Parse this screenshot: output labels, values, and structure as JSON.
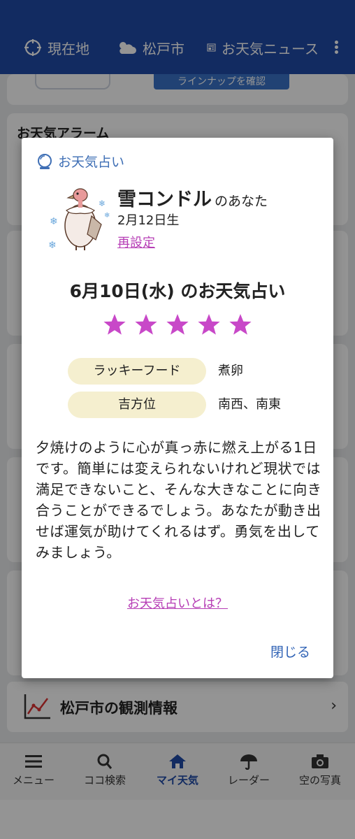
{
  "topbar": {
    "nav_current": "現在地",
    "nav_city": "松戸市",
    "nav_news": "お天気ニュース"
  },
  "background": {
    "lineup_button": "ラインナップを確認",
    "alarm_title": "お天気アラーム",
    "obs_label": "松戸市の観測情報"
  },
  "bottom_nav": {
    "items": [
      {
        "label": "メニュー",
        "icon": "menu-icon"
      },
      {
        "label": "ココ検索",
        "icon": "search-icon"
      },
      {
        "label": "マイ天気",
        "icon": "home-icon"
      },
      {
        "label": "レーダー",
        "icon": "umbrella-icon"
      },
      {
        "label": "空の写真",
        "icon": "camera-icon"
      }
    ],
    "active": "マイ天気"
  },
  "modal": {
    "header": "お天気占い",
    "name": "雪コンドル",
    "name_suffix": "のあなた",
    "birthday": "2月12日生",
    "reset": "再設定",
    "fortune_title": "6月10日(水) のお天気占い",
    "stars": 5,
    "star_color": "#c848c8",
    "lucky_food_label": "ラッキーフード",
    "lucky_food_value": "煮卵",
    "direction_label": "吉方位",
    "direction_value": "南西、南東",
    "description": "夕焼けのように心が真っ赤に燃え上がる1日です。簡単には変えられないけれど現状では満足できないこと、そんな大きなことに向き合うことができるでしょう。あなたが動き出せば運気が助けてくれるはず。勇気を出してみましょう。",
    "about_link": "お天気占いとは？",
    "close": "閉じる"
  },
  "colors": {
    "brand": "#1f4aa8",
    "link_purple": "#b63db5",
    "pill_bg": "#f5efcf",
    "close_blue": "#2f62b5"
  }
}
